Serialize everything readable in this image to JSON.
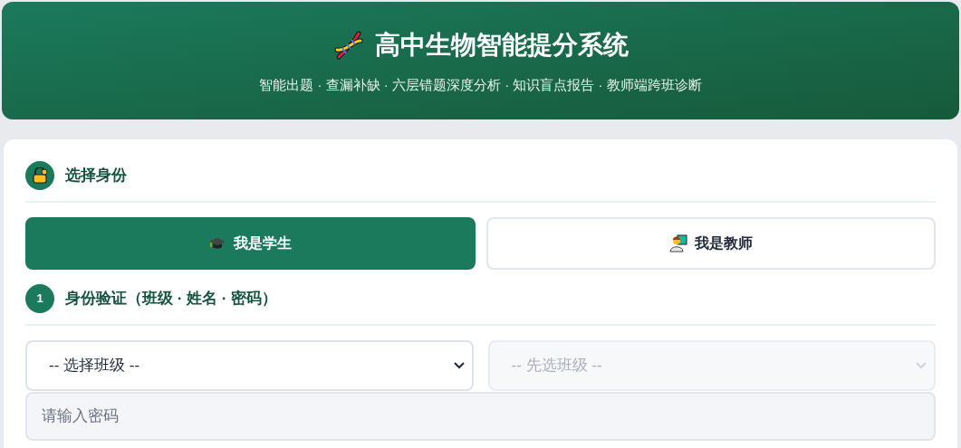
{
  "header": {
    "title": "高中生物智能提分系统",
    "subtitle": "智能出题 · 查漏补缺 · 六层错题深度分析 · 知识盲点报告 · 教师端跨班诊断"
  },
  "sections": [
    {
      "kind": "roles",
      "badge": {
        "kind": "lock"
      },
      "title": "选择身份"
    },
    {
      "kind": "login",
      "badge": {
        "kind": "number",
        "text": "1"
      },
      "title": "身份验证（班级 · 姓名 · 密码）"
    }
  ],
  "roles": [
    {
      "label": "我是学生",
      "kind": "student",
      "selected": true
    },
    {
      "label": "我是教师",
      "kind": "teacher",
      "selected": false
    }
  ],
  "selects": [
    {
      "value": "-- 选择班级 --",
      "disabled": false
    },
    {
      "value": "-- 先选班级 --",
      "disabled": true
    }
  ],
  "password": {
    "placeholder": "请输入密码"
  }
}
